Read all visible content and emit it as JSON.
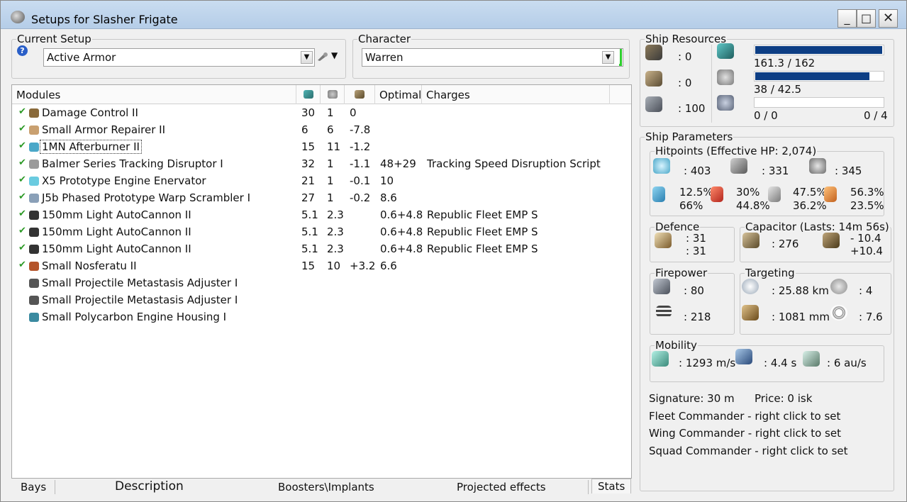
{
  "window": {
    "title": "Setups for Slasher Frigate",
    "min": "_",
    "max": "□",
    "close": "✕"
  },
  "current_setup": {
    "legend": "Current Setup",
    "help": "?",
    "value": "Active Armor",
    "arrow": "▼"
  },
  "character": {
    "legend": "Character",
    "value": "Warren",
    "arrow": "▼"
  },
  "modules": {
    "headers": [
      "Modules",
      "",
      "",
      "",
      "Optimal",
      "Charges"
    ],
    "rows": [
      {
        "name": "Damage Control II",
        "c1": "30",
        "c2": "1",
        "c3": "0",
        "optimal": "",
        "charges": "",
        "checked": true
      },
      {
        "name": "Small Armor Repairer II",
        "c1": "6",
        "c2": "6",
        "c3": "-7.8",
        "optimal": "",
        "charges": "",
        "checked": true
      },
      {
        "name": "1MN Afterburner II",
        "c1": "15",
        "c2": "11",
        "c3": "-1.2",
        "optimal": "",
        "charges": "",
        "checked": true
      },
      {
        "name": "Balmer Series Tracking Disruptor I",
        "c1": "32",
        "c2": "1",
        "c3": "-1.1",
        "optimal": "48+29",
        "charges": "Tracking Speed Disruption Script",
        "checked": true
      },
      {
        "name": "X5 Prototype Engine Enervator",
        "c1": "21",
        "c2": "1",
        "c3": "-0.1",
        "optimal": "10",
        "charges": "",
        "checked": true
      },
      {
        "name": "J5b Phased Prototype Warp Scrambler I",
        "c1": "27",
        "c2": "1",
        "c3": "-0.2",
        "optimal": "8.6",
        "charges": "",
        "checked": true
      },
      {
        "name": "150mm Light AutoCannon II",
        "c1": "5.1",
        "c2": "2.3",
        "c3": "",
        "optimal": "0.6+4.8",
        "charges": "Republic Fleet EMP S",
        "checked": true
      },
      {
        "name": "150mm Light AutoCannon II",
        "c1": "5.1",
        "c2": "2.3",
        "c3": "",
        "optimal": "0.6+4.8",
        "charges": "Republic Fleet EMP S",
        "checked": true
      },
      {
        "name": "150mm Light AutoCannon II",
        "c1": "5.1",
        "c2": "2.3",
        "c3": "",
        "optimal": "0.6+4.8",
        "charges": "Republic Fleet EMP S",
        "checked": true
      },
      {
        "name": "Small Nosferatu II",
        "c1": "15",
        "c2": "10",
        "c3": "+3.2",
        "optimal": "6.6",
        "charges": "",
        "checked": true
      },
      {
        "name": "Small Projectile Metastasis Adjuster I",
        "c1": "",
        "c2": "",
        "c3": "",
        "optimal": "",
        "charges": "",
        "checked": false
      },
      {
        "name": "Small Projectile Metastasis Adjuster I",
        "c1": "",
        "c2": "",
        "c3": "",
        "optimal": "",
        "charges": "",
        "checked": false
      },
      {
        "name": "Small Polycarbon Engine Housing I",
        "c1": "",
        "c2": "",
        "c3": "",
        "optimal": "",
        "charges": "",
        "checked": false
      }
    ]
  },
  "bottom_tabs": [
    "Bays",
    "Description",
    "Boosters\\Implants",
    "Projected effects",
    "Stats"
  ],
  "ship_resources": {
    "legend": "Ship Resources",
    "hardpoints": [
      ": 0",
      ": 0",
      ": 100"
    ],
    "cpu": {
      "text": "161.3 / 162",
      "fraction": 0.996
    },
    "power": {
      "text": "38 / 42.5",
      "fraction": 0.894
    },
    "calib": {
      "left": "0 / 0",
      "right": "0 / 4",
      "fraction": 0
    }
  },
  "ship_parameters": {
    "legend": "Ship Parameters",
    "hitpoints": {
      "legend": "Hitpoints (Effective HP: 2,074)",
      "shield": ": 403",
      "armor": ": 331",
      "hull": ": 345",
      "res": [
        {
          "top": "12.5%",
          "bottom": "66%"
        },
        {
          "top": "30%",
          "bottom": "44.8%"
        },
        {
          "top": "47.5%",
          "bottom": "36.2%"
        },
        {
          "top": "56.3%",
          "bottom": "23.5%"
        }
      ]
    },
    "defence": {
      "legend": "Defence",
      "a": ": 31",
      "b": ": 31"
    },
    "capacitor": {
      "legend": "Capacitor (Lasts: 14m 56s)",
      "value": ": 276",
      "delta1": "- 10.4",
      "delta2": "+10.4"
    },
    "firepower": {
      "legend": "Firepower",
      "a": ": 80",
      "b": ": 218"
    },
    "targeting": {
      "legend": "Targeting",
      "range": ": 25.88 km",
      "res": ": 1081 mm",
      "max": ": 4",
      "sensor": ": 7.6"
    },
    "mobility": {
      "legend": "Mobility",
      "speed": ": 1293 m/s",
      "align": ": 4.4 s",
      "warp": ": 6 au/s"
    },
    "signature": "Signature: 30 m",
    "price": "Price: 0 isk",
    "fleet": "Fleet Commander - right click to set",
    "wing": "Wing Commander - right click to set",
    "squad": "Squad Commander - right click to set"
  }
}
